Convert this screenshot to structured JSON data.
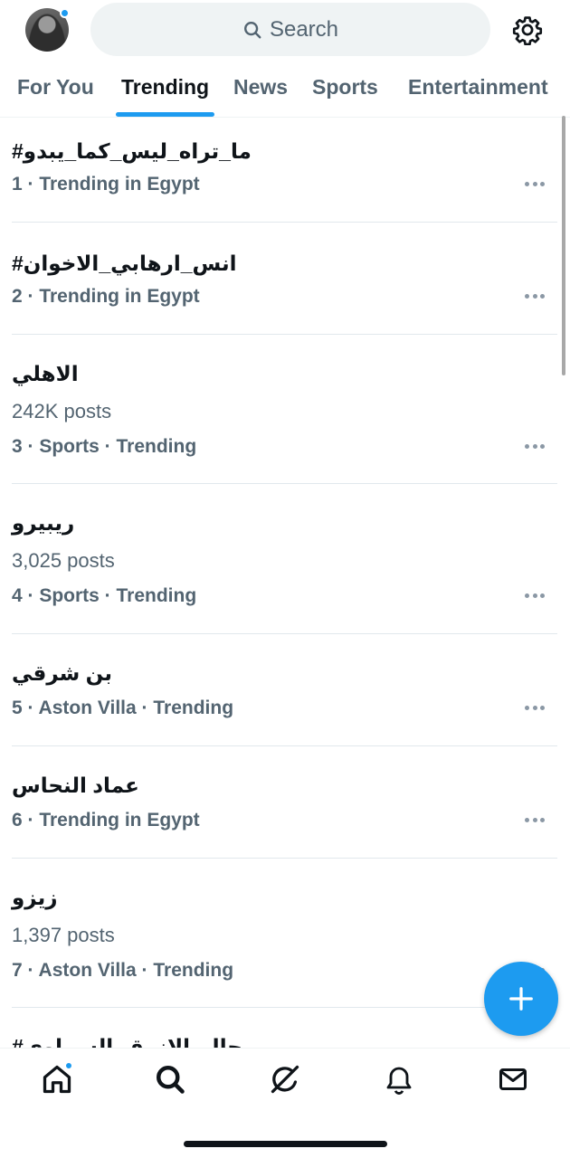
{
  "header": {
    "search_placeholder": "Search",
    "has_notification_dot": true
  },
  "tabs": [
    {
      "label": "For You",
      "active": false
    },
    {
      "label": "Trending",
      "active": true
    },
    {
      "label": "News",
      "active": false
    },
    {
      "label": "Sports",
      "active": false
    },
    {
      "label": "Entertainment",
      "active": false
    }
  ],
  "trends": [
    {
      "title": "#ما_تراه_ليس_كما_يبدو",
      "posts": "",
      "context": "1 · Trending in Egypt"
    },
    {
      "title": "#انس_ارهابي_الاخوان",
      "posts": "",
      "context": "2 · Trending in Egypt"
    },
    {
      "title": "الاهلي",
      "posts": "242K posts",
      "context": "3 · Sports · Trending"
    },
    {
      "title": "ريبيرو",
      "posts": "3,025 posts",
      "context": "4 · Sports · Trending"
    },
    {
      "title": "بن شرقي",
      "posts": "",
      "context": "5 · Aston Villa · Trending"
    },
    {
      "title": "عماد النحاس",
      "posts": "",
      "context": "6 · Trending in Egypt"
    },
    {
      "title": "زيزو",
      "posts": "1,397 posts",
      "context": "7 · Aston Villa · Trending"
    },
    {
      "title": "#رحال_الازرق_السماوي",
      "posts": "",
      "context": ""
    }
  ],
  "bottom_nav": [
    {
      "icon": "home-icon",
      "active": true
    },
    {
      "icon": "search-icon",
      "active": false
    },
    {
      "icon": "grok-icon",
      "active": false
    },
    {
      "icon": "bell-icon",
      "active": false
    },
    {
      "icon": "mail-icon",
      "active": false
    }
  ],
  "colors": {
    "accent": "#1d9bf0",
    "text_primary": "#0f1419",
    "text_secondary": "#536471",
    "search_bg": "#eff3f4"
  }
}
